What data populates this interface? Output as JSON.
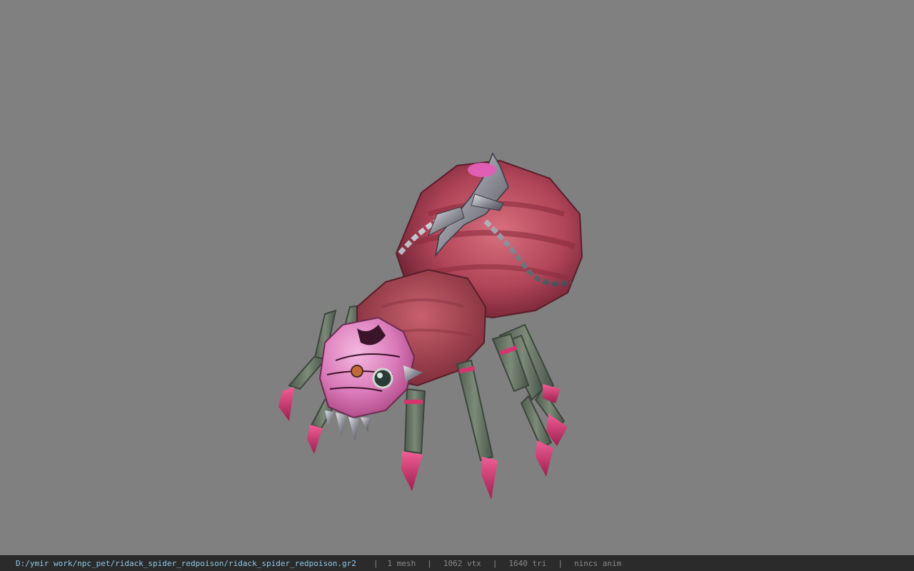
{
  "viewer": {
    "model_name": "ridack_spider_redpoison",
    "background_color": "#808080"
  },
  "status": {
    "file_path": "D:/ymir work/npc_pet/ridack_spider_redpoison/ridack_spider_redpoison.gr2",
    "separator": "|",
    "mesh": "1 mesh",
    "vertices": "1062 vtx",
    "triangles": "1640 tri",
    "anim": "nincs anim"
  },
  "colors": {
    "body": "#b24a5c",
    "leg": "#5f6e5f",
    "claw": "#d8336f",
    "head": "#e28bc4",
    "metal": "#8c8c96"
  }
}
